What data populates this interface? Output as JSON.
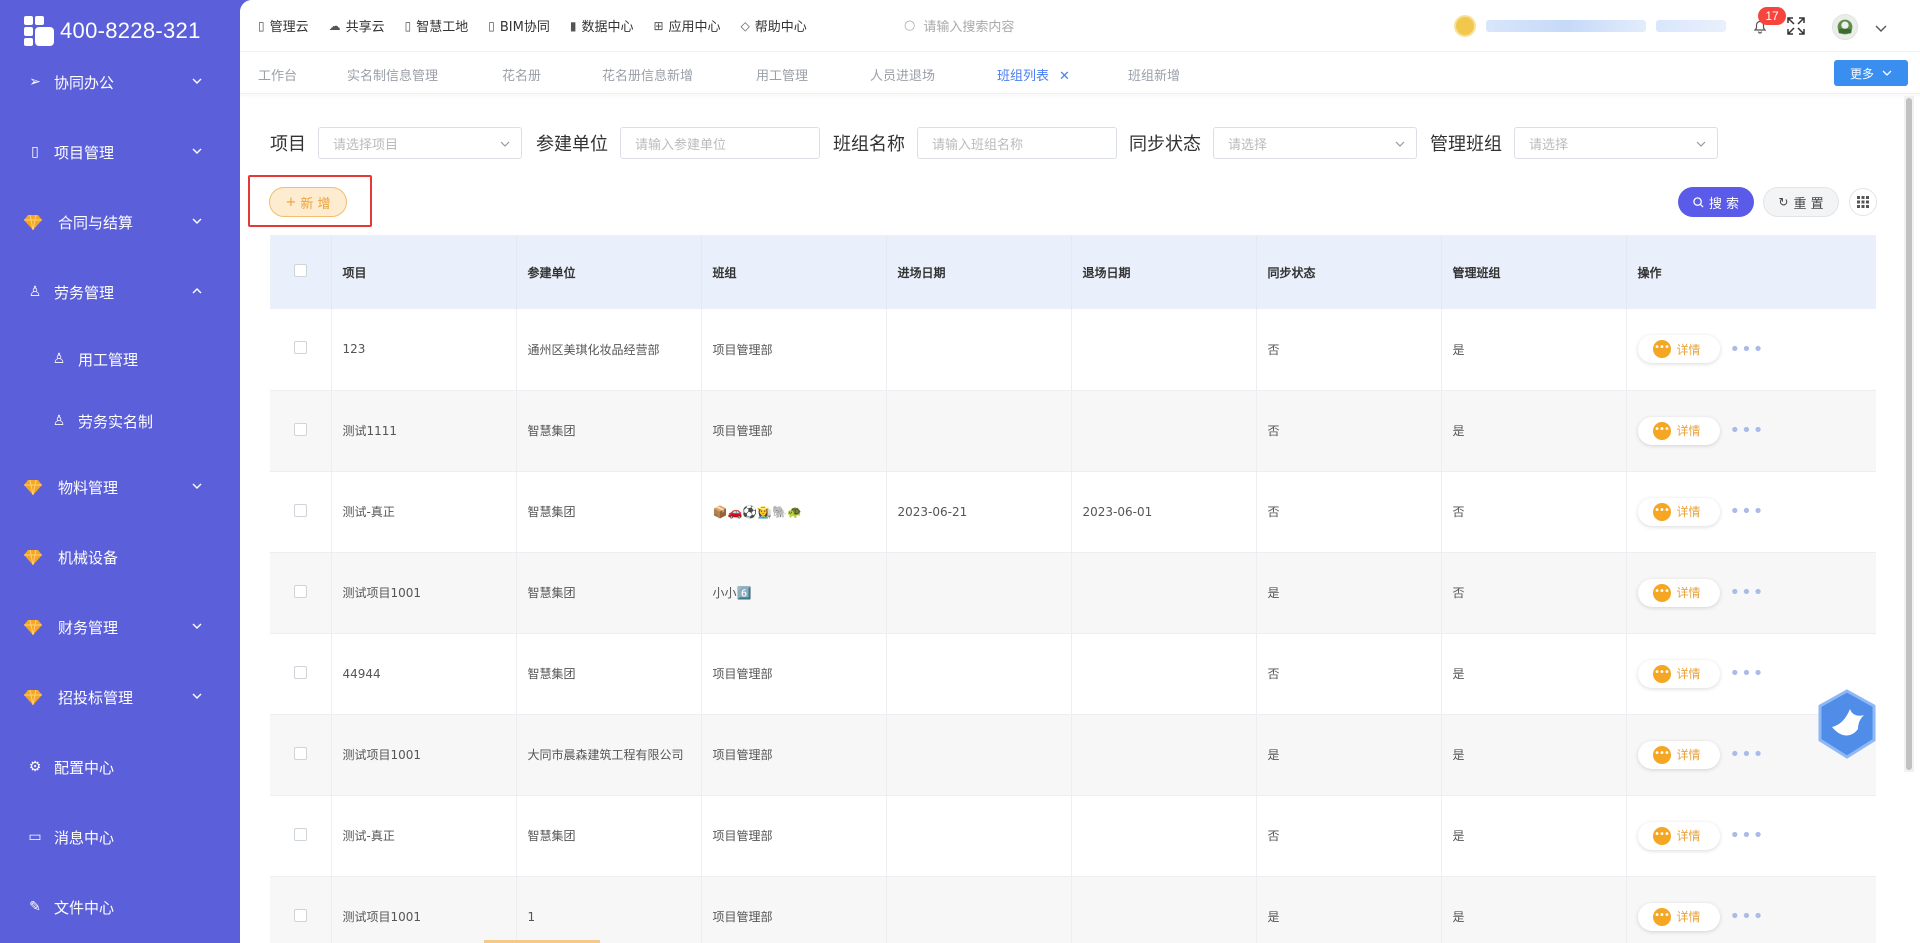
{
  "brand": {
    "phone": "400-8228-321"
  },
  "sidebar": {
    "items": [
      {
        "label": "协同办公",
        "icon": "send-icon"
      },
      {
        "label": "项目管理",
        "icon": "book-icon"
      },
      {
        "label": "合同与结算",
        "icon": "gem-icon"
      },
      {
        "label": "劳务管理",
        "icon": "users-icon"
      },
      {
        "label": "用工管理",
        "icon": "user-icon"
      },
      {
        "label": "劳务实名制",
        "icon": "users-icon"
      },
      {
        "label": "物料管理",
        "icon": "gem-icon"
      },
      {
        "label": "机械设备",
        "icon": "gem-icon"
      },
      {
        "label": "财务管理",
        "icon": "gem-icon"
      },
      {
        "label": "招投标管理",
        "icon": "gem-icon"
      },
      {
        "label": "配置中心",
        "icon": "gear-icon"
      },
      {
        "label": "消息中心",
        "icon": "message-icon"
      },
      {
        "label": "文件中心",
        "icon": "file-icon"
      }
    ]
  },
  "topnav": {
    "items": [
      {
        "label": "管理云",
        "icon": "book-icon"
      },
      {
        "label": "共享云",
        "icon": "cloud-icon"
      },
      {
        "label": "智慧工地",
        "icon": "book-icon"
      },
      {
        "label": "BIM协同",
        "icon": "book-icon"
      },
      {
        "label": "数据中心",
        "icon": "bar-chart-icon"
      },
      {
        "label": "应用中心",
        "icon": "grid-icon"
      },
      {
        "label": "帮助中心",
        "icon": "diamond-icon"
      }
    ],
    "search_placeholder": "请输入搜索内容",
    "notification_count": "17"
  },
  "tabs": {
    "items": [
      "工作台",
      "实名制信息管理",
      "花名册",
      "花名册信息新增",
      "用工管理",
      "人员进退场",
      "班组列表",
      "班组新增"
    ],
    "active": "班组列表",
    "close_symbol": "✕",
    "more_label": "更多"
  },
  "filters": {
    "project": {
      "label": "项目",
      "placeholder": "请选择项目"
    },
    "unit": {
      "label": "参建单位",
      "placeholder": "请输入参建单位"
    },
    "team_name": {
      "label": "班组名称",
      "placeholder": "请输入班组名称"
    },
    "sync_status": {
      "label": "同步状态",
      "placeholder": "请选择"
    },
    "manage_team": {
      "label": "管理班组",
      "placeholder": "请选择"
    }
  },
  "actions": {
    "add_label": "新 增",
    "search_label": "搜 索",
    "reset_label": "重 置"
  },
  "table": {
    "columns": [
      "项目",
      "参建单位",
      "班组",
      "进场日期",
      "退场日期",
      "同步状态",
      "管理班组",
      "操作"
    ],
    "detail_label": "详情",
    "rows": [
      {
        "project": "123",
        "unit": "通州区美琪化妆品经营部",
        "team": "项目管理部",
        "entry": "",
        "exit": "",
        "sync": "否",
        "manage": "是"
      },
      {
        "project": "测试1111",
        "unit": "智慧集团",
        "team": "项目管理部",
        "entry": "",
        "exit": "",
        "sync": "否",
        "manage": "是"
      },
      {
        "project": "测试-真正",
        "unit": "智慧集团",
        "team": "📦🚗⚽👩‍🌾🐘🐢",
        "entry": "2023-06-21",
        "exit": "2023-06-01",
        "sync": "否",
        "manage": "否"
      },
      {
        "project": "测试项目1001",
        "unit": "智慧集团",
        "team": "小小6️⃣",
        "entry": "",
        "exit": "",
        "sync": "是",
        "manage": "否"
      },
      {
        "project": "44944",
        "unit": "智慧集团",
        "team": "项目管理部",
        "entry": "",
        "exit": "",
        "sync": "否",
        "manage": "是"
      },
      {
        "project": "测试项目1001",
        "unit": "大同市晨森建筑工程有限公司",
        "team": "项目管理部",
        "entry": "",
        "exit": "",
        "sync": "是",
        "manage": "是"
      },
      {
        "project": "测试-真正",
        "unit": "智慧集团",
        "team": "项目管理部",
        "entry": "",
        "exit": "",
        "sync": "否",
        "manage": "是"
      },
      {
        "project": "测试项目1001",
        "unit": "1",
        "team": "项目管理部",
        "entry": "",
        "exit": "",
        "sync": "是",
        "manage": "是"
      }
    ]
  },
  "colors": {
    "sidebar": "#5b5fd9",
    "accent": "#5a5be8",
    "tab_active": "#4a7df0",
    "add_button": "#e9a23b",
    "highlight_frame": "#e53935"
  }
}
